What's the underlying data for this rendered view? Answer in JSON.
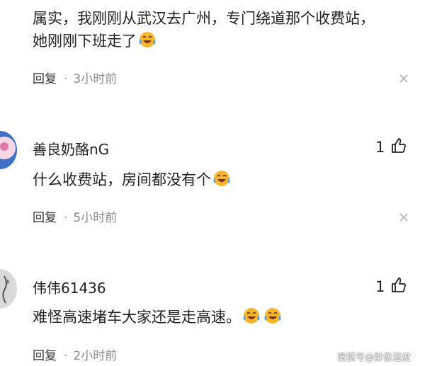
{
  "comments": [
    {
      "body_line1": "属实，我刚刚从武汉去广州，专门绕道那个收费站，",
      "body_line2": "她刚刚下班走了",
      "reply_label": "回复",
      "separator": "·",
      "time": "3小时前",
      "emoji": "laughing-crying-emoji"
    },
    {
      "username": "善良奶酪nG",
      "like_count": "1",
      "body": "什么收费站，房间都没有个",
      "reply_label": "回复",
      "separator": "·",
      "time": "5小时前",
      "emoji": "laughing-crying-emoji"
    },
    {
      "username": "伟伟61436",
      "like_count": "1",
      "body": "难怪高速堵车大家还是走高速。",
      "reply_label": "回复",
      "separator": "·",
      "time": "2小时前",
      "emoji": "laughing-crying-emoji"
    }
  ],
  "watermark": "搜狐号@影像温度",
  "colors": {
    "emoji_face": "#f7b52b",
    "emoji_tear": "#4aa3e8",
    "muted": "#8a8a8a"
  }
}
